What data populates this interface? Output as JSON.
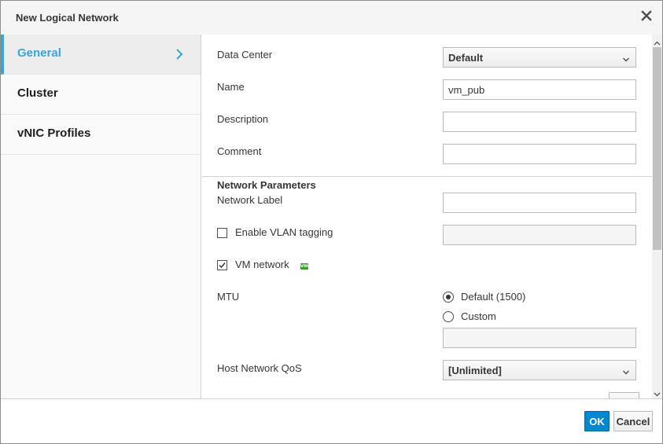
{
  "dialog": {
    "title": "New Logical Network",
    "ok_label": "OK",
    "cancel_label": "Cancel"
  },
  "sidebar": {
    "items": [
      {
        "label": "General",
        "active": true
      },
      {
        "label": "Cluster",
        "active": false
      },
      {
        "label": "vNIC Profiles",
        "active": false
      }
    ]
  },
  "form": {
    "data_center": {
      "label": "Data Center",
      "value": "Default"
    },
    "name": {
      "label": "Name",
      "value": "vm_pub"
    },
    "description": {
      "label": "Description",
      "value": ""
    },
    "comment": {
      "label": "Comment",
      "value": ""
    },
    "section_title": "Network Parameters",
    "network_label": {
      "label": "Network Label",
      "value": ""
    },
    "vlan": {
      "label": "Enable VLAN tagging",
      "checked": false,
      "value": ""
    },
    "vm_network": {
      "label": "VM network",
      "checked": true,
      "icon_text": "vm"
    },
    "mtu": {
      "label": "MTU",
      "options": [
        {
          "label": "Default (1500)",
          "selected": true
        },
        {
          "label": "Custom",
          "selected": false
        }
      ],
      "custom_value": ""
    },
    "host_qos": {
      "label": "Host Network QoS",
      "value": "[Unlimited]"
    }
  },
  "colors": {
    "accent": "#39a5dc",
    "primary_button": "#0088ce",
    "vm_icon": "#3f9c35"
  },
  "icons": {
    "close": "close-icon",
    "chevron": "chevron-right-icon",
    "caret": "chevron-down-icon"
  }
}
